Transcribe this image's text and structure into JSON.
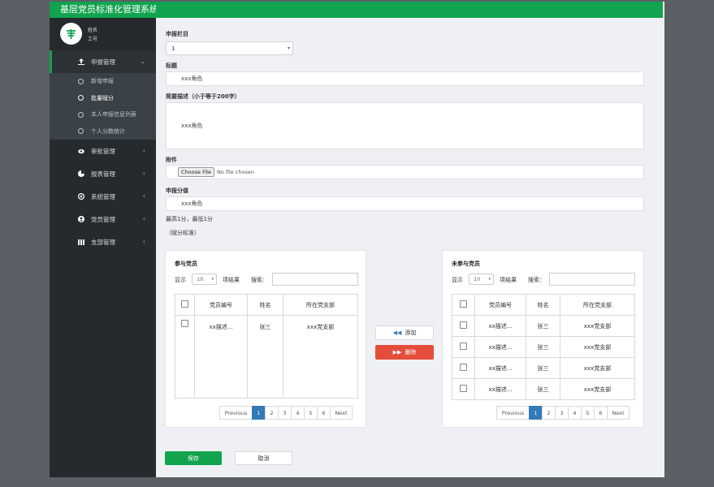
{
  "app": {
    "title": "基层党员标准化管理系统"
  },
  "user": {
    "name": "姓名",
    "id_label": "工号"
  },
  "sidebar": {
    "items": [
      {
        "label": "申报管理",
        "icon": "upload-icon"
      },
      {
        "label": "审批管理",
        "icon": "eye-icon"
      },
      {
        "label": "报表管理",
        "icon": "pie-chart-icon"
      },
      {
        "label": "系统管理",
        "icon": "target-icon"
      },
      {
        "label": "党员管理",
        "icon": "user-icon"
      },
      {
        "label": "支部管理",
        "icon": "columns-icon"
      }
    ],
    "sub_items": [
      {
        "label": "新增申报"
      },
      {
        "label": "批量赋分"
      },
      {
        "label": "本人申报信息列表"
      },
      {
        "label": "个人分数统计"
      }
    ]
  },
  "form": {
    "category_label": "申报栏目",
    "category_value": "1",
    "title_label": "标题",
    "title_value": "xxx角色",
    "desc_label": "简要描述（小于等于200字）",
    "desc_value": "xxx角色",
    "attach_label": "附件",
    "file_button": "Choose File",
    "file_status": "No file chosen",
    "score_label": "申报分值",
    "score_value": "xxx角色",
    "range_note": "最高1分，最低1分",
    "standard_note": "（赋分标准）"
  },
  "left_panel": {
    "title": "参与党员",
    "show_label": "显示",
    "page_len": "10",
    "results_label": "项结果",
    "search_label": "搜索：",
    "headers": [
      "党员编号",
      "姓名",
      "所在党支部"
    ],
    "rows": [
      {
        "id": "xx描述...",
        "name": "张三",
        "branch": "xxx党支部"
      }
    ]
  },
  "right_panel": {
    "title": "未参与党员",
    "show_label": "显示",
    "page_len": "10",
    "results_label": "项结果",
    "search_label": "搜索：",
    "headers": [
      "党员编号",
      "姓名",
      "所在党支部"
    ],
    "rows": [
      {
        "id": "xx描述...",
        "name": "张三",
        "branch": "xxx党支部"
      },
      {
        "id": "xx描述...",
        "name": "张三",
        "branch": "xxx党支部"
      },
      {
        "id": "xx描述...",
        "name": "张三",
        "branch": "xxx党支部"
      },
      {
        "id": "xx描述...",
        "name": "张三",
        "branch": "xxx党支部"
      }
    ]
  },
  "pagination": {
    "prev": "Previous",
    "next": "Next",
    "pages": [
      "1",
      "2",
      "3",
      "4",
      "5",
      "6"
    ],
    "current": "1"
  },
  "transfer": {
    "add_label": "添加",
    "delete_label": "删除"
  },
  "actions": {
    "save_label": "保存",
    "cancel_label": "取消"
  },
  "colors": {
    "brand": "#12a34f",
    "sidebar": "#252a2f",
    "danger": "#e64c3c",
    "primary": "#337ab7"
  }
}
